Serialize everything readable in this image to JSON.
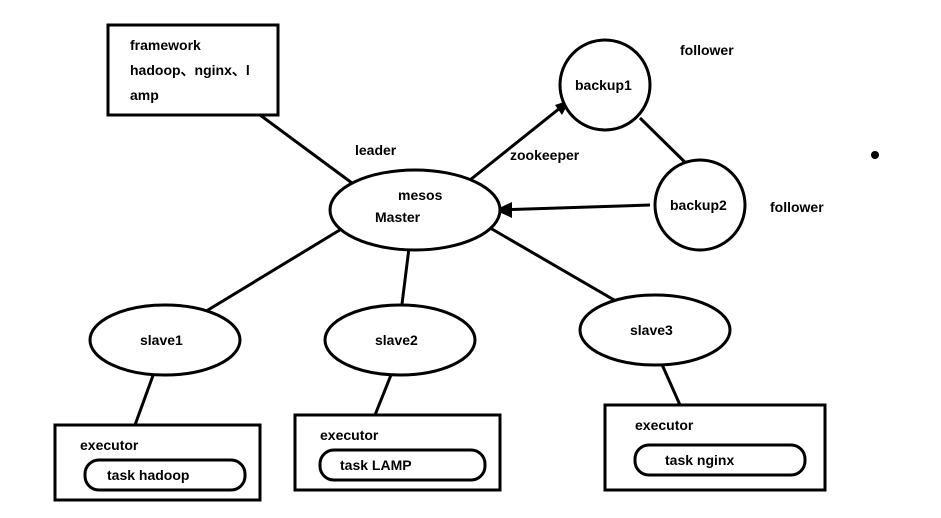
{
  "framework": {
    "line1": "framework",
    "line2": "hadoop、nginx、l",
    "line3": "amp"
  },
  "master": {
    "line1": "mesos",
    "line2": "Master",
    "label": "leader"
  },
  "backup1": {
    "name": "backup1",
    "label": "follower"
  },
  "backup2": {
    "name": "backup2",
    "label": "follower"
  },
  "zookeeper_label": "zookeeper",
  "slaves": {
    "s1": "slave1",
    "s2": "slave2",
    "s3": "slave3"
  },
  "executors": {
    "e1": {
      "title": "executor",
      "task": "task    hadoop"
    },
    "e2": {
      "title": "executor",
      "task": "task   LAMP"
    },
    "e3": {
      "title": "executor",
      "task": "task  nginx"
    }
  },
  "dot": "."
}
